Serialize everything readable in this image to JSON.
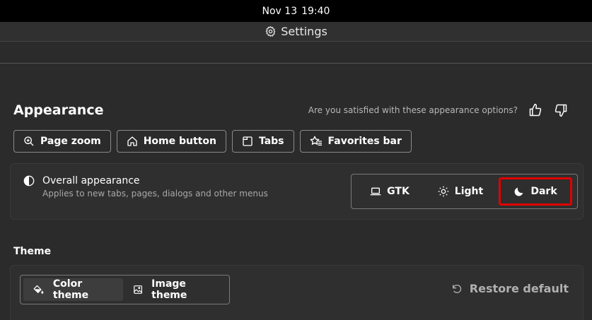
{
  "system": {
    "date": "Nov 13",
    "time": "19:40"
  },
  "window": {
    "title": "Settings"
  },
  "appearance": {
    "heading": "Appearance",
    "feedback_question": "Are you satisfied with these appearance options?",
    "chips": [
      {
        "label": "Page zoom",
        "icon": "zoom-in-icon"
      },
      {
        "label": "Home button",
        "icon": "home-icon"
      },
      {
        "label": "Tabs",
        "icon": "tab-icon"
      },
      {
        "label": "Favorites bar",
        "icon": "favorites-icon"
      }
    ],
    "overall": {
      "title": "Overall appearance",
      "subtitle": "Applies to new tabs, pages, dialogs and other menus",
      "options": [
        "GTK",
        "Light",
        "Dark"
      ],
      "selected": "Dark"
    }
  },
  "theme": {
    "heading": "Theme",
    "tabs": [
      "Color theme",
      "Image theme"
    ],
    "selected": "Color theme",
    "restore_label": "Restore default"
  },
  "colors": {
    "highlight": "#e00000",
    "background": "#2b2b2b"
  }
}
